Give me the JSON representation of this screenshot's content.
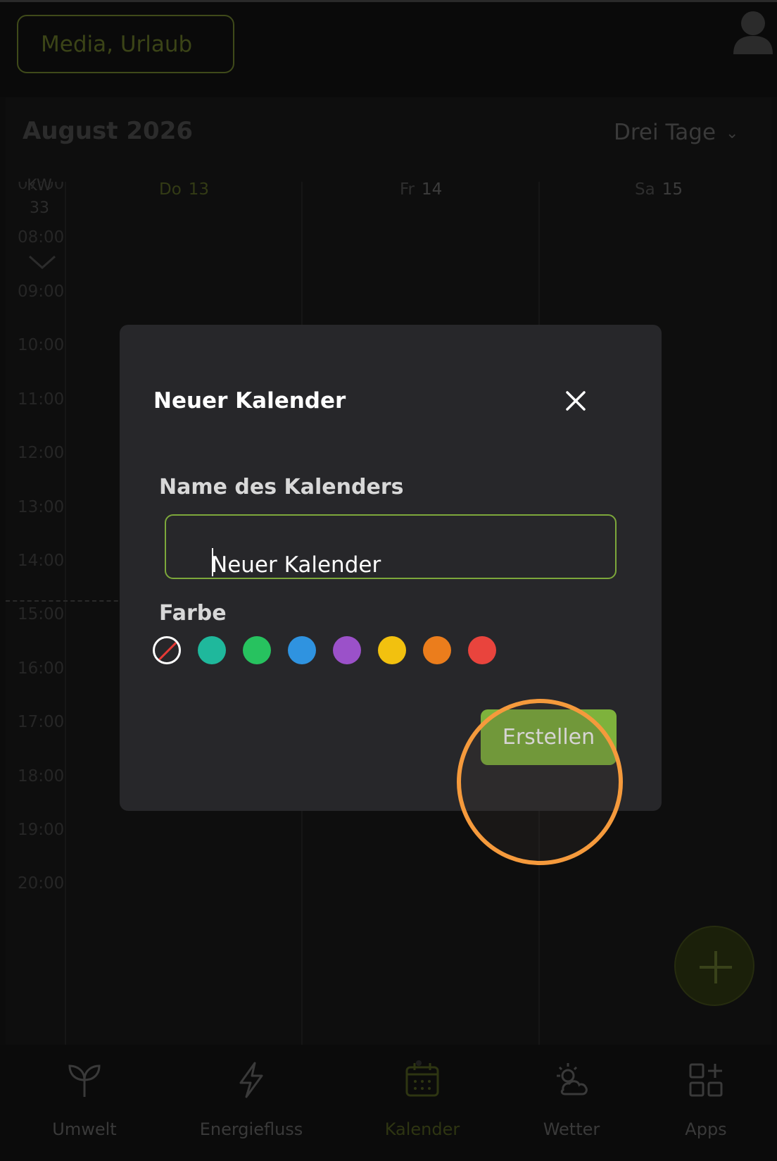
{
  "topbar": {
    "calendar_selector": "Media, Urlaub"
  },
  "calendar": {
    "month_label": "August 2026",
    "view_selector": "Drei Tage",
    "week_label": "KW",
    "week_number": "33",
    "days": [
      {
        "weekday": "Do",
        "day": "13"
      },
      {
        "weekday": "Fr",
        "day": "14"
      },
      {
        "weekday": "Sa",
        "day": "15"
      }
    ],
    "times": [
      "07:00",
      "08:00",
      "09:00",
      "10:00",
      "11:00",
      "12:00",
      "13:00",
      "14:00",
      "15:00",
      "16:00",
      "17:00",
      "18:00",
      "19:00",
      "20:00"
    ]
  },
  "bottom_nav": {
    "items": [
      {
        "label": "Umwelt",
        "icon": "sprout-icon"
      },
      {
        "label": "Energiefluss",
        "icon": "lightning-icon"
      },
      {
        "label": "Kalender",
        "icon": "calendar-icon",
        "active": true
      },
      {
        "label": "Wetter",
        "icon": "sun-cloud-icon"
      },
      {
        "label": "Apps",
        "icon": "apps-grid-icon"
      }
    ]
  },
  "modal": {
    "title": "Neuer Kalender",
    "name_label": "Name des Kalenders",
    "name_value": "Neuer Kalender",
    "color_label": "Farbe",
    "colors": [
      "none",
      "#1fb89c",
      "#27c25f",
      "#2f93e0",
      "#9b51c9",
      "#f2c10f",
      "#eb7d1c",
      "#e9443d"
    ],
    "create_button": "Erstellen"
  },
  "colors": {
    "accent": "#7eb23c",
    "highlight_ring": "#f59a3c",
    "modal_bg": "#27272a"
  }
}
